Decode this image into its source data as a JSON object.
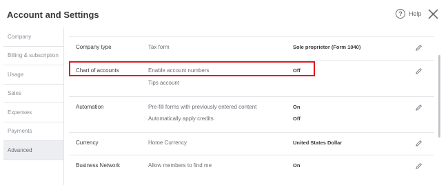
{
  "header": {
    "title": "Account and Settings",
    "help_label": "Help"
  },
  "sidebar": {
    "items": [
      {
        "label": "Company"
      },
      {
        "label": "Billing & subscription"
      },
      {
        "label": "Usage"
      },
      {
        "label": "Sales"
      },
      {
        "label": "Expenses"
      },
      {
        "label": "Payments"
      },
      {
        "label": "Advanced"
      }
    ],
    "active": "Advanced"
  },
  "sections": {
    "company_type": {
      "title": "Company type",
      "label": "Tax form",
      "value": "Sole proprietor (Form 1040)"
    },
    "chart_of_accounts": {
      "title": "Chart of accounts",
      "label": "Enable account numbers",
      "value": "Off",
      "label2": "Tips account"
    },
    "automation": {
      "title": "Automation",
      "label": "Pre-fill forms with previously entered content",
      "value": "On",
      "label2": "Automatically apply credits",
      "value2": "Off"
    },
    "currency": {
      "title": "Currency",
      "label": "Home Currency",
      "value": "United States Dollar"
    },
    "business_network": {
      "title": "Business Network",
      "label": "Allow members to find me",
      "value": "On"
    }
  },
  "colors": {
    "highlight": "#e8141b",
    "active_bg": "#eceef1"
  },
  "icons": [
    "help-icon",
    "close-icon",
    "pencil-icon"
  ]
}
